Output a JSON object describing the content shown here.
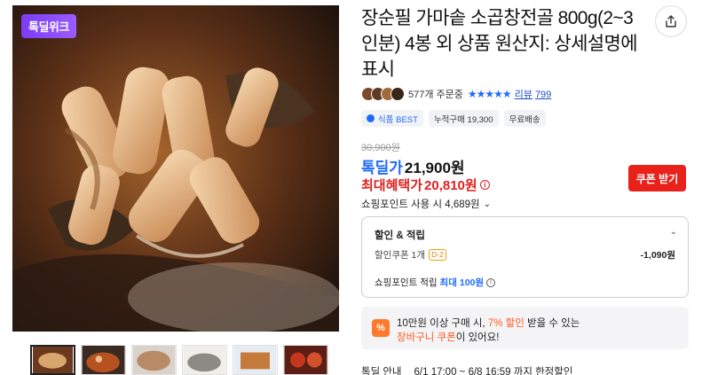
{
  "product": {
    "badge": "톡딜위크",
    "title": "장순필 가마솥 소곱창전골 800g(2~3인분) 4봉 외 상품 원산지: 상세설명에 표시",
    "order_count": "577개 주문중",
    "stars": "★★★★★",
    "review_label": "리뷰",
    "review_count": "799"
  },
  "tags": [
    "식품 BEST",
    "누적구매 19,300",
    "무료배송"
  ],
  "price": {
    "original": "30,900원",
    "deal_label": "톡딜가",
    "deal_price": "21,900원",
    "max_label": "최대혜택가",
    "max_price": "20,810원",
    "coupon_button": "쿠폰 받기",
    "points_use": "쇼핑포인트 사용 시 4,689원"
  },
  "discount_box": {
    "header": "할인 & 적립",
    "coupon_label": "할인쿠폰 1개",
    "dday": "D-2",
    "coupon_amount": "-1,090원",
    "points_label": "쇼핑포인트 적립",
    "points_max_label": "최대",
    "points_amount": "100원"
  },
  "promo": {
    "icon": "%",
    "line1_pre": "10만원 이상 구매 시, ",
    "line1_highlight": "7% 할인",
    "line1_post": " 받을 수 있는",
    "line2_highlight": "장바구니 쿠폰",
    "line2_post": "이 있어요!"
  },
  "deal_info": {
    "label": "톡딜 안내",
    "period": "6/1 17:00 ~ 6/8 16:59 까지 한정할인"
  },
  "colors": {
    "accent_blue": "#1e6bff",
    "price_red": "#e02020",
    "coupon_red": "#e8221b",
    "badge_purple": "#7b3cf5",
    "promo_orange": "#ff5a1f"
  },
  "icons": {
    "share": "share-icon",
    "chevron": "chevron-down-icon",
    "info": "info-icon",
    "percent": "percent-icon"
  }
}
